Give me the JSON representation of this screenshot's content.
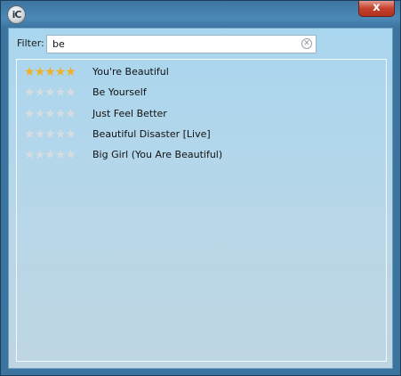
{
  "window": {
    "app_icon_text": "iC",
    "close_label": "x"
  },
  "filter": {
    "label": "Filter:",
    "value": "be"
  },
  "results": [
    {
      "title": "You're Beautiful",
      "rating": 5
    },
    {
      "title": "Be Yourself",
      "rating": 0
    },
    {
      "title": "Just Feel Better",
      "rating": 0
    },
    {
      "title": "Beautiful Disaster [Live]",
      "rating": 0
    },
    {
      "title": "Big Girl (You Are Beautiful)",
      "rating": 0
    }
  ],
  "rating_max": 5,
  "colors": {
    "star_on": "#f0b02a",
    "star_off": "#d6dde2"
  }
}
